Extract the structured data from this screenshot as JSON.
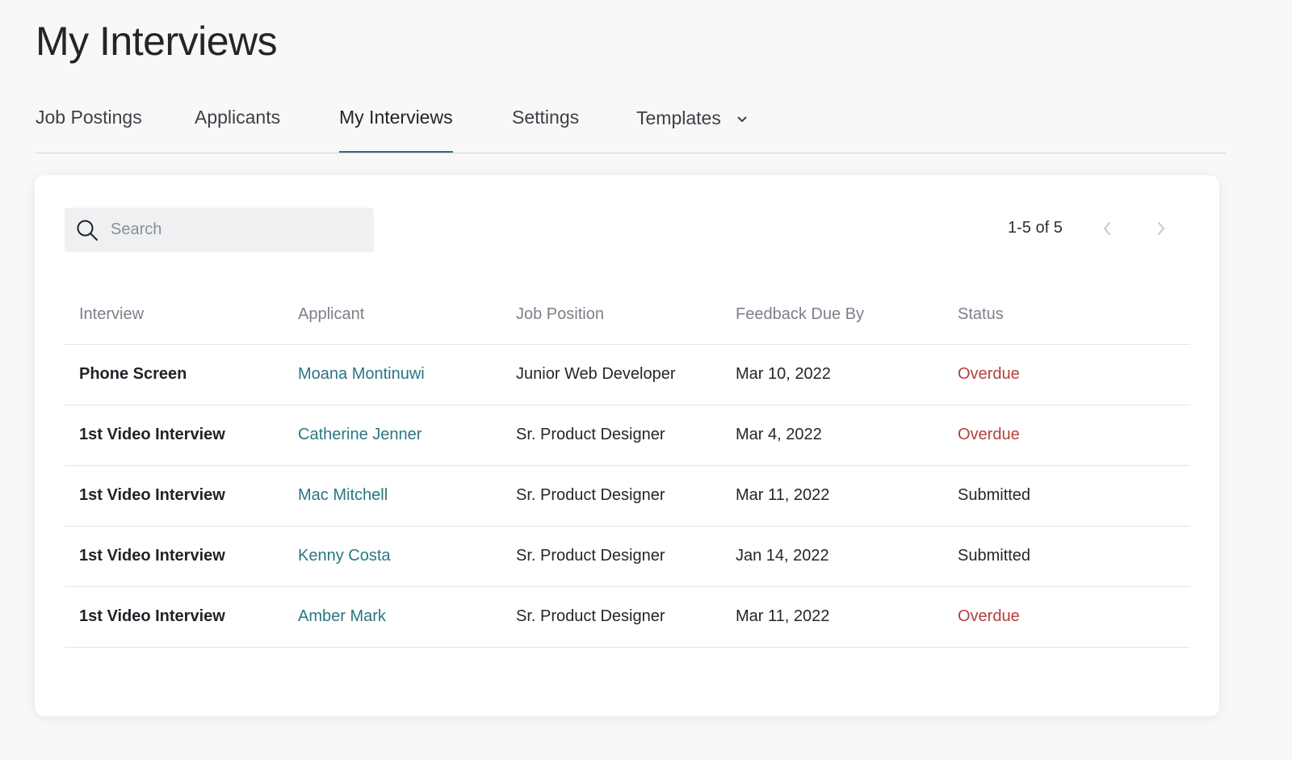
{
  "page": {
    "title": "My Interviews"
  },
  "tabs": [
    {
      "label": "Job Postings"
    },
    {
      "label": "Applicants"
    },
    {
      "label": "My Interviews",
      "active": true
    },
    {
      "label": "Settings"
    },
    {
      "label": "Templates",
      "icon": "chevron-down-icon"
    }
  ],
  "search": {
    "placeholder": "Search",
    "value": ""
  },
  "pagination": {
    "range_text": "1-5 of 5",
    "prev_icon": "chevron-left-icon",
    "next_icon": "chevron-right-icon"
  },
  "table": {
    "columns": [
      "Interview",
      "Applicant",
      "Job Position",
      "Feedback Due By",
      "Status"
    ],
    "rows": [
      {
        "interview": "Phone Screen",
        "applicant": "Moana Montinuwi",
        "position": "Junior Web Developer",
        "due": "Mar 10, 2022",
        "status": "Overdue"
      },
      {
        "interview": "1st Video Interview",
        "applicant": "Catherine Jenner",
        "position": "Sr. Product Designer",
        "due": "Mar 4, 2022",
        "status": "Overdue"
      },
      {
        "interview": "1st Video Interview",
        "applicant": "Mac Mitchell",
        "position": "Sr. Product Designer",
        "due": "Mar 11, 2022",
        "status": "Submitted"
      },
      {
        "interview": "1st Video Interview",
        "applicant": "Kenny Costa",
        "position": "Sr. Product Designer",
        "due": "Jan 14, 2022",
        "status": "Submitted"
      },
      {
        "interview": "1st Video Interview",
        "applicant": "Amber Mark",
        "position": "Sr. Product Designer",
        "due": "Mar 11, 2022",
        "status": "Overdue"
      }
    ]
  },
  "colors": {
    "accent": "#2d6a86",
    "link": "#2b7683",
    "overdue": "#b4403b"
  }
}
